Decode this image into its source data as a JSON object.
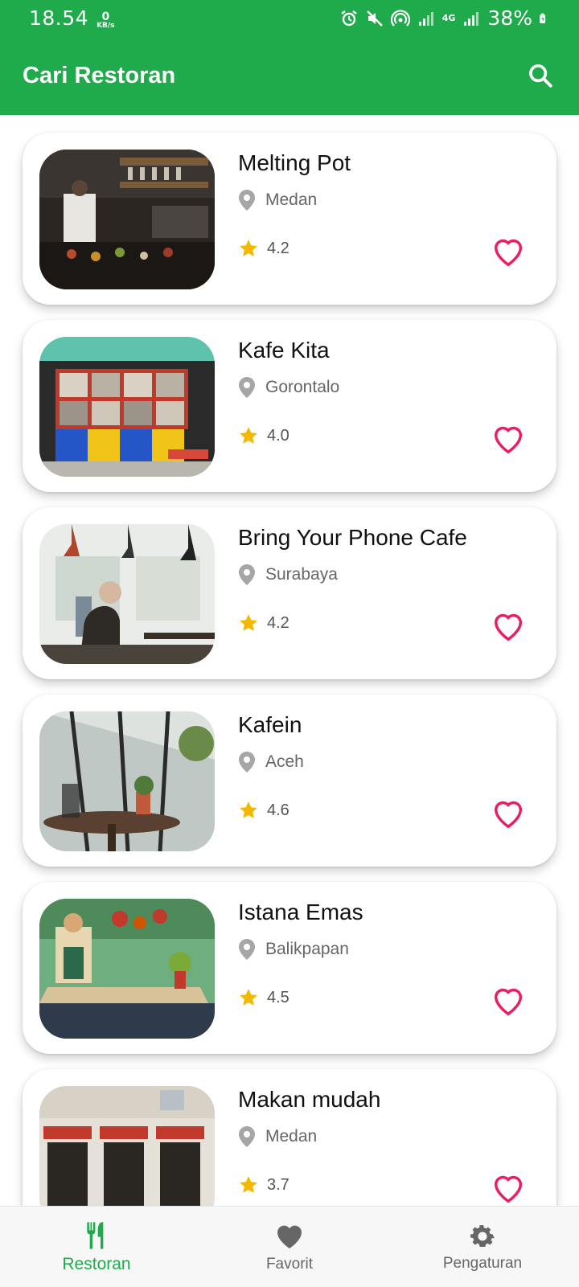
{
  "status_bar": {
    "time": "18.54",
    "netspeed_value": "0",
    "netspeed_unit": "KB/s",
    "signal_label": "4G",
    "battery": "38%"
  },
  "app_bar": {
    "title": "Cari Restoran",
    "search_icon": "search-icon"
  },
  "colors": {
    "primary": "#1faa4b",
    "star": "#f5b800",
    "heart": "#e91e63",
    "pin": "#9e9e9e"
  },
  "restaurants": [
    {
      "name": "Melting Pot",
      "city": "Medan",
      "rating": "4.2"
    },
    {
      "name": "Kafe Kita",
      "city": "Gorontalo",
      "rating": "4.0"
    },
    {
      "name": "Bring Your Phone Cafe",
      "city": "Surabaya",
      "rating": "4.2"
    },
    {
      "name": "Kafein",
      "city": "Aceh",
      "rating": "4.6"
    },
    {
      "name": "Istana Emas",
      "city": "Balikpapan",
      "rating": "4.5"
    },
    {
      "name": "Makan mudah",
      "city": "Medan",
      "rating": "3.7"
    }
  ],
  "bottom_nav": {
    "items": [
      {
        "label": "Restoran",
        "icon": "restaurant-icon",
        "active": true
      },
      {
        "label": "Favorit",
        "icon": "heart-icon",
        "active": false
      },
      {
        "label": "Pengaturan",
        "icon": "gear-icon",
        "active": false
      }
    ]
  }
}
